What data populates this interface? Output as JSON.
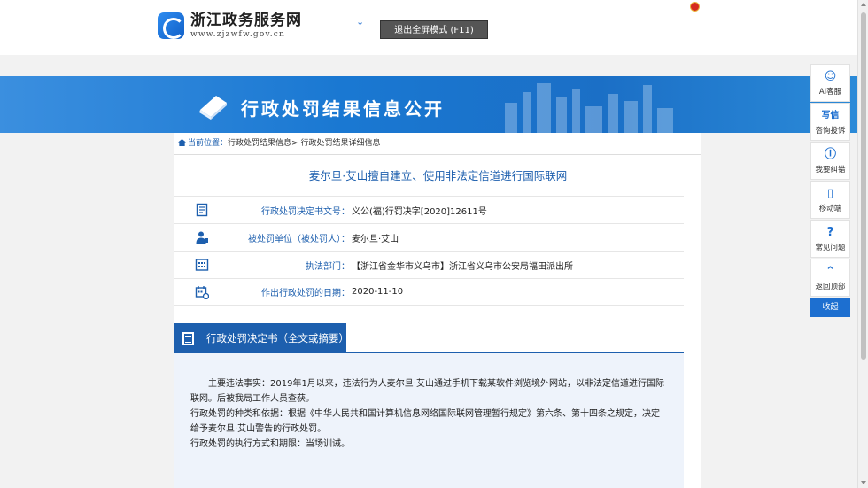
{
  "header": {
    "site_title": "浙江政务服务网",
    "site_url": "www.zjzwfw.gov.cn",
    "fullscreen_button": "退出全屏模式 (F11)"
  },
  "banner": {
    "title": "行政处罚结果信息公开"
  },
  "breadcrumb": {
    "prefix": "当前位置：",
    "level1": "行政处罚结果信息",
    "separator": ">",
    "level2": "行政处罚结果详细信息"
  },
  "case": {
    "title": "麦尔旦·艾山擅自建立、使用非法定信道进行国际联网",
    "rows": [
      {
        "icon": "document-number-icon",
        "label": "行政处罚决定书文号：",
        "value": "义公(福)行罚决字[2020]12611号"
      },
      {
        "icon": "person-icon",
        "label": "被处罚单位（被处罚人）：",
        "value": "麦尔旦·艾山"
      },
      {
        "icon": "building-icon",
        "label": "执法部门：",
        "value": "【浙江省金华市义乌市】浙江省义乌市公安局福田派出所"
      },
      {
        "icon": "calendar-icon",
        "label": "作出行政处罚的日期：",
        "value": "2020-11-10"
      }
    ]
  },
  "decision": {
    "tab_label": "行政处罚决定书（全文或摘要）",
    "para1": "主要违法事实：2019年1月以来，违法行为人麦尔旦·艾山通过手机下载某软件浏览境外网站，以非法定信道进行国际联网。后被我局工作人员查获。",
    "para2": "行政处罚的种类和依据：根据《中华人民共和国计算机信息网络国际联网管理暂行规定》第六条、第十四条之规定，决定给予麦尔旦·艾山警告的行政处罚。",
    "para3": "行政处罚的执行方式和期限：当场训诫。"
  },
  "rail": {
    "items": [
      {
        "icon": "ai-chat-icon",
        "glyph": "☺",
        "label": "AI客服"
      },
      {
        "icon": "letter-icon",
        "glyph": "写信",
        "label": "咨询投诉"
      },
      {
        "icon": "info-icon",
        "glyph": "ⓘ",
        "label": "我要纠错"
      },
      {
        "icon": "mobile-icon",
        "glyph": "▯",
        "label": "移动端"
      },
      {
        "icon": "question-icon",
        "glyph": "?",
        "label": "常见问题"
      },
      {
        "icon": "back-to-top-icon",
        "glyph": "⌃",
        "label": "返回顶部"
      }
    ],
    "collapse_label": "收起"
  },
  "colors": {
    "primary": "#1d5fae",
    "banner": "#1a78d2",
    "body_bg": "#f2f2f2",
    "section_bg": "#eef3fb"
  }
}
